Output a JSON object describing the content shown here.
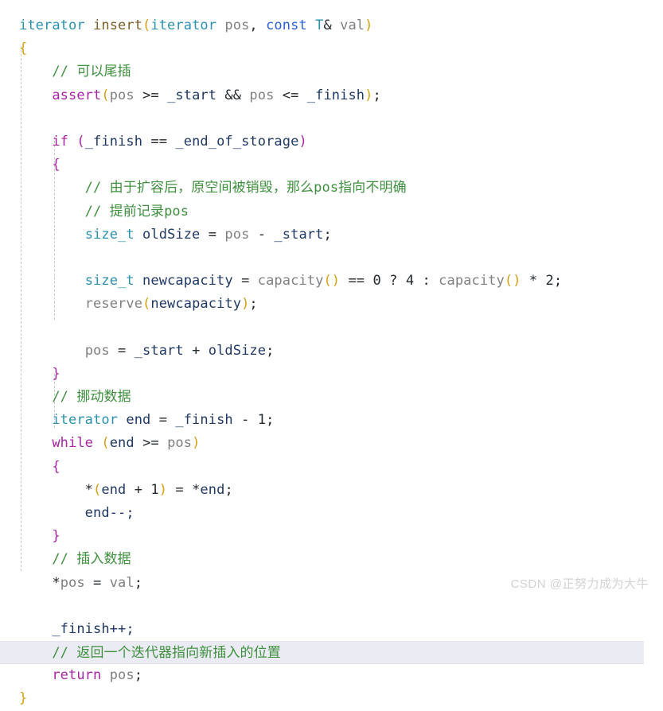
{
  "editor": {
    "language": "cpp",
    "background": "#ffffff",
    "highlighted_line_index": 25,
    "colors": {
      "type": "#2b91af",
      "function": "#795e26",
      "keyword": "#2b5fd9",
      "control_keyword": "#a626a4",
      "parameter": "#808080",
      "variable": "#1f3864",
      "comment": "#3f8f3f",
      "bracket_level_1": "#d6a014",
      "bracket_level_2": "#a626a4",
      "bracket_level_3": "#2b91af",
      "line_highlight": "#ebecf3",
      "indent_guide": "#c8c8c8",
      "watermark": "#d2d2d2"
    },
    "lines": [
      {
        "n": 1,
        "text": "iterator insert(iterator pos, const T& val)"
      },
      {
        "n": 2,
        "text": "{"
      },
      {
        "n": 3,
        "text": "    // 可以尾插"
      },
      {
        "n": 4,
        "text": "    assert(pos >= _start && pos <= _finish);"
      },
      {
        "n": 5,
        "text": ""
      },
      {
        "n": 6,
        "text": "    if (_finish == _end_of_storage)"
      },
      {
        "n": 7,
        "text": "    {"
      },
      {
        "n": 8,
        "text": "        // 由于扩容后，原空间被销毁，那么pos指向不明确"
      },
      {
        "n": 9,
        "text": "        // 提前记录pos"
      },
      {
        "n": 10,
        "text": "        size_t oldSize = pos - _start;"
      },
      {
        "n": 11,
        "text": ""
      },
      {
        "n": 12,
        "text": "        size_t newcapacity = capacity() == 0 ? 4 : capacity() * 2;"
      },
      {
        "n": 13,
        "text": "        reserve(newcapacity);"
      },
      {
        "n": 14,
        "text": ""
      },
      {
        "n": 15,
        "text": "        pos = _start + oldSize;"
      },
      {
        "n": 16,
        "text": "    }"
      },
      {
        "n": 17,
        "text": "    // 挪动数据"
      },
      {
        "n": 18,
        "text": "    iterator end = _finish - 1;"
      },
      {
        "n": 19,
        "text": "    while (end >= pos)"
      },
      {
        "n": 20,
        "text": "    {"
      },
      {
        "n": 21,
        "text": "        *(end + 1) = *end;"
      },
      {
        "n": 22,
        "text": "        end--;"
      },
      {
        "n": 23,
        "text": "    }"
      },
      {
        "n": 24,
        "text": "    // 插入数据"
      },
      {
        "n": 25,
        "text": "    *pos = val;"
      },
      {
        "n": 26,
        "text": ""
      },
      {
        "n": 27,
        "text": "    _finish++;"
      },
      {
        "n": 28,
        "text": "    // 返回一个迭代器指向新插入的位置"
      },
      {
        "n": 29,
        "text": "    return pos;"
      },
      {
        "n": 30,
        "text": "}"
      }
    ],
    "tokens": {
      "l1": {
        "a": "iterator",
        "b": " insert",
        "c": "(",
        "d": "iterator",
        "e": " pos",
        "f": ", ",
        "g": "const",
        "h": " T",
        "i": "& ",
        "j": "val",
        "k": ")"
      },
      "l2": {
        "a": "{"
      },
      "l3": {
        "a": "    // 可以尾插"
      },
      "l4": {
        "a": "    ",
        "b": "assert",
        "c": "(",
        "d": "pos",
        "e": " >= ",
        "f": "_start",
        "g": " && ",
        "h": "pos",
        "i": " <= ",
        "j": "_finish",
        "k": ")",
        "l": ";"
      },
      "l6": {
        "a": "    ",
        "b": "if",
        "c": " ",
        "d": "(",
        "e": "_finish",
        "f": " == ",
        "g": "_end_of_storage",
        "h": ")"
      },
      "l7": {
        "a": "    ",
        "b": "{"
      },
      "l8": {
        "a": "        // 由于扩容后，原空间被销毁，那么pos指向不明确"
      },
      "l9": {
        "a": "        // 提前记录pos"
      },
      "l10": {
        "a": "        ",
        "b": "size_t",
        "c": " oldSize",
        "d": " = ",
        "e": "pos",
        "f": " - ",
        "g": "_start",
        "h": ";"
      },
      "l12": {
        "a": "        ",
        "b": "size_t",
        "c": " newcapacity",
        "d": " = ",
        "e": "capacity",
        "f": "()",
        "g": " == ",
        "h": "0",
        "i": " ? ",
        "j": "4",
        "k": " : ",
        "l": "capacity",
        "m": "()",
        "n": " * ",
        "o": "2",
        "p": ";"
      },
      "l13": {
        "a": "        ",
        "b": "reserve",
        "c": "(",
        "d": "newcapacity",
        "e": ")",
        "f": ";"
      },
      "l15": {
        "a": "        ",
        "b": "pos",
        "c": " = ",
        "d": "_start",
        "e": " + ",
        "f": "oldSize",
        "g": ";"
      },
      "l16": {
        "a": "    ",
        "b": "}"
      },
      "l17": {
        "a": "    // 挪动数据"
      },
      "l18": {
        "a": "    ",
        "b": "iterator",
        "c": " end",
        "d": " = ",
        "e": "_finish",
        "f": " - ",
        "g": "1",
        "h": ";"
      },
      "l19": {
        "a": "    ",
        "b": "while",
        "c": " ",
        "d": "(",
        "e": "end",
        "f": " >= ",
        "g": "pos",
        "h": ")"
      },
      "l20": {
        "a": "    ",
        "b": "{"
      },
      "l21": {
        "a": "        *",
        "b": "(",
        "c": "end",
        "d": " + ",
        "e": "1",
        "f": ")",
        "g": " = *",
        "h": "end",
        "i": ";"
      },
      "l22": {
        "a": "        end--;"
      },
      "l23": {
        "a": "    ",
        "b": "}"
      },
      "l24": {
        "a": "    // 插入数据"
      },
      "l25": {
        "a": "    *",
        "b": "pos",
        "c": " = ",
        "d": "val",
        "e": ";"
      },
      "l27": {
        "a": "    _finish++;"
      },
      "l28": {
        "a": "    // 返回一个迭代器指向新插入的位置"
      },
      "l29": {
        "a": "    ",
        "b": "return",
        "c": " ",
        "d": "pos",
        "e": ";"
      },
      "l30": {
        "a": "}"
      }
    }
  },
  "watermark": {
    "text": "CSDN @正努力成为大牛"
  }
}
